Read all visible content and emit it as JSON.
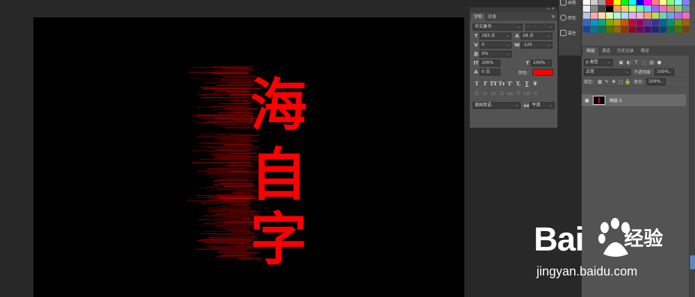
{
  "canvas": {
    "artwork_chars": [
      "海",
      "自",
      "字"
    ],
    "text_color": "#ff0000",
    "background": "#000000"
  },
  "dock": {
    "items": [
      {
        "label": "画笔",
        "icon": "brush-icon"
      },
      {
        "label": "颜色",
        "icon": "color-icon"
      },
      {
        "label": "属性",
        "icon": "properties-icon"
      }
    ]
  },
  "character_panel": {
    "tabs": [
      "字符",
      "段落"
    ],
    "font_family": "华文隶书",
    "font_style": "-",
    "font_size": "183 点",
    "leading": "28 点",
    "kerning": "0",
    "tracking": "-120",
    "tsume": "0%",
    "vertical_scale": "100%",
    "horizontal_scale": "100%",
    "baseline_shift": "0 点",
    "color_label": "颜色：",
    "color_value": "#ff0000",
    "type_buttons": [
      "T",
      "T",
      "TT",
      "Tт",
      "T'",
      "T,",
      "T",
      "T"
    ],
    "opentype_buttons": [
      "fi",
      "σ",
      "st",
      "A",
      "aa",
      "T",
      "1st",
      "½"
    ],
    "language": "美国英语",
    "antialias_label": "aa",
    "antialias": "平滑"
  },
  "layers_panel": {
    "tabs": [
      "图层",
      "通道",
      "历史记录",
      "路径"
    ],
    "filter_kind": "ρ 类型",
    "blend_mode": "正常",
    "opacity_label": "不透明度：",
    "opacity": "100%",
    "lock_label": "锁定：",
    "fill_label": "填充：",
    "fill": "100%",
    "layer_name": "图层 0"
  },
  "swatch_colors": [
    "#ffffff",
    "#cccccc",
    "#999999",
    "#ff0000",
    "#ffff00",
    "#00ff00",
    "#00ffff",
    "#0000ff",
    "#ff00ff",
    "#ff8080",
    "#ffff80",
    "#80ff80",
    "#80ffff",
    "#8080ff",
    "#eeeeee",
    "#888888",
    "#444444",
    "#000000",
    "#ff9966",
    "#ffcc66",
    "#ccff66",
    "#66ff99",
    "#66ccff",
    "#9966ff",
    "#ff66cc",
    "#cc9966",
    "#99cc66",
    "#669999",
    "#aaccee",
    "#ffaaaa",
    "#ffddaa",
    "#ddffaa",
    "#aaffdd",
    "#aaddff",
    "#ddaaff",
    "#ffaadd",
    "#f7a46a",
    "#b9d46a",
    "#6ad4b9",
    "#6aa4f7",
    "#b96af7",
    "#f76ab9",
    "#3366cc",
    "#0099cc",
    "#00aa88",
    "#88aa00",
    "#cc9900",
    "#cc5500",
    "#cc0033",
    "#990066",
    "#663399",
    "#333399",
    "#006699",
    "#009966",
    "#669900",
    "#996600",
    "#1144aa",
    "#007799",
    "#007755",
    "#557700",
    "#996600",
    "#993300",
    "#990022",
    "#770055",
    "#441177",
    "#222277",
    "#004477",
    "#007744",
    "#447700",
    "#774400"
  ]
}
